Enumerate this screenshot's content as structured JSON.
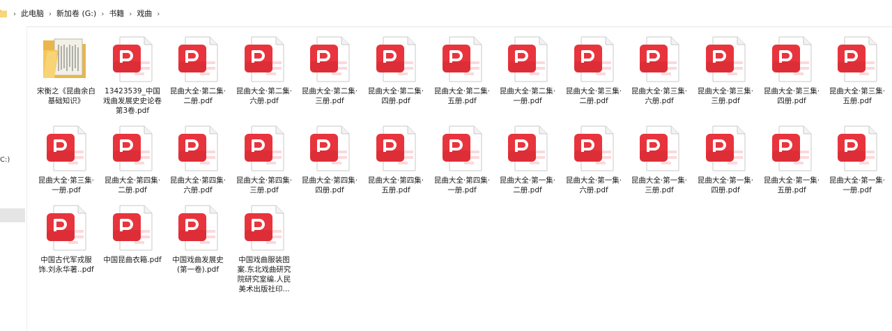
{
  "breadcrumb": [
    "此电脑",
    "新加卷 (G:)",
    "书籍",
    "戏曲"
  ],
  "nav": {
    "partial_label": "C:)"
  },
  "files": [
    {
      "type": "folder",
      "label": "宋衡之《昆曲余白基础知识》"
    },
    {
      "type": "pdf",
      "label": "13423539_中国戏曲发展史史论卷第3卷.pdf"
    },
    {
      "type": "pdf",
      "label": "昆曲大全·第二集·二册.pdf"
    },
    {
      "type": "pdf",
      "label": "昆曲大全·第二集·六册.pdf"
    },
    {
      "type": "pdf",
      "label": "昆曲大全·第二集·三册.pdf"
    },
    {
      "type": "pdf",
      "label": "昆曲大全·第二集·四册.pdf"
    },
    {
      "type": "pdf",
      "label": "昆曲大全·第二集·五册.pdf"
    },
    {
      "type": "pdf",
      "label": "昆曲大全·第二集·一册.pdf"
    },
    {
      "type": "pdf",
      "label": "昆曲大全·第三集·二册.pdf"
    },
    {
      "type": "pdf",
      "label": "昆曲大全·第三集·六册.pdf"
    },
    {
      "type": "pdf",
      "label": "昆曲大全·第三集·三册.pdf"
    },
    {
      "type": "pdf",
      "label": "昆曲大全·第三集·四册.pdf"
    },
    {
      "type": "pdf",
      "label": "昆曲大全·第三集·五册.pdf"
    },
    {
      "type": "pdf",
      "label": "昆曲大全·第三集·一册.pdf"
    },
    {
      "type": "pdf",
      "label": "昆曲大全·第四集·二册.pdf"
    },
    {
      "type": "pdf",
      "label": "昆曲大全·第四集·六册.pdf"
    },
    {
      "type": "pdf",
      "label": "昆曲大全·第四集·三册.pdf"
    },
    {
      "type": "pdf",
      "label": "昆曲大全·第四集·四册.pdf"
    },
    {
      "type": "pdf",
      "label": "昆曲大全·第四集·五册.pdf"
    },
    {
      "type": "pdf",
      "label": "昆曲大全·第四集·一册.pdf"
    },
    {
      "type": "pdf",
      "label": "昆曲大全·第一集·二册.pdf"
    },
    {
      "type": "pdf",
      "label": "昆曲大全·第一集·六册.pdf"
    },
    {
      "type": "pdf",
      "label": "昆曲大全·第一集·三册.pdf"
    },
    {
      "type": "pdf",
      "label": "昆曲大全·第一集·四册.pdf"
    },
    {
      "type": "pdf",
      "label": "昆曲大全·第一集·五册.pdf"
    },
    {
      "type": "pdf",
      "label": "昆曲大全·第一集·一册.pdf"
    },
    {
      "type": "pdf",
      "label": "中国古代军戎服饰.刘永华著..pdf"
    },
    {
      "type": "pdf",
      "label": "中国昆曲衣箱.pdf"
    },
    {
      "type": "pdf",
      "label": "中国戏曲发展史(第一卷).pdf"
    },
    {
      "type": "pdf",
      "label": "中国戏曲服装图案.东北戏曲研究院研究室编.人民美术出版社印..."
    }
  ],
  "colors": {
    "pdf_red": "#e8343d",
    "pdf_pink": "#f7c5c8",
    "folder_yellow": "#f5c85c"
  }
}
